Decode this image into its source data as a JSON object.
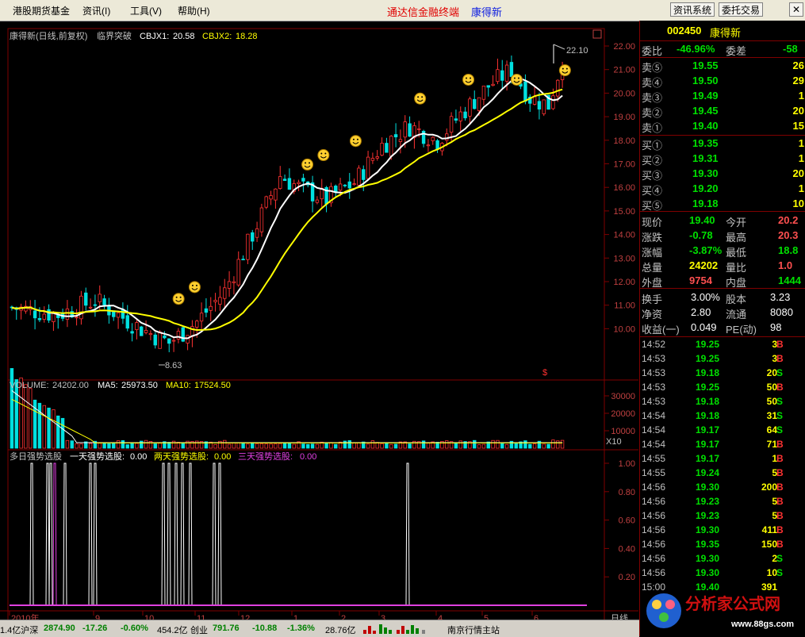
{
  "menu": {
    "items": [
      "港股期货基金",
      "资讯",
      "工具",
      "帮助"
    ],
    "keys": [
      "(I)",
      "(V)",
      "(H)"
    ],
    "center_title": "通达信金融终端",
    "stock_title": "康得新",
    "btn_info": "资讯系统",
    "btn_trade": "委托交易",
    "close": "✕"
  },
  "main_chart": {
    "header_name": "康得新(日线,前复权)",
    "indicator": "临界突破",
    "cbjx1_label": "CBJX1:",
    "cbjx1_value": "20.58",
    "cbjx2_label": "CBJX2:",
    "cbjx2_value": "18.28",
    "high_label": "22.10",
    "low_label": "8.63",
    "yticks": [
      "22.00",
      "21.00",
      "20.00",
      "19.00",
      "18.00",
      "17.00",
      "16.00",
      "15.00",
      "14.00",
      "13.00",
      "12.00",
      "11.00",
      "10.00"
    ],
    "marker": "$"
  },
  "volume_chart": {
    "label": "VOLUME:",
    "value": "24202.00",
    "ma5_label": "MA5:",
    "ma5_value": "25973.50",
    "ma10_label": "MA10:",
    "ma10_value": "17524.50",
    "yticks": [
      "30000",
      "20000",
      "10000"
    ],
    "unit": "X10"
  },
  "signal_chart": {
    "title": "多日强势选股",
    "s1_label": "一天强势选股:",
    "s1_value": "0.00",
    "s2_label": "两天强势选股:",
    "s2_value": "0.00",
    "s3_label": "三天强势选股:",
    "s3_value": "0.00",
    "yticks": [
      "1.00",
      "0.80",
      "0.60",
      "0.40",
      "0.20"
    ]
  },
  "xaxis": {
    "labels": [
      "2010年",
      "9",
      "10",
      "11",
      "12",
      "1",
      "2",
      "3",
      "4",
      "5",
      "6"
    ],
    "period": "日线"
  },
  "quote": {
    "code": "002450",
    "name": "康得新",
    "weibi_label": "委比",
    "weibi_value": "-46.96%",
    "weicha_label": "委差",
    "weicha_value": "-58",
    "asks": [
      {
        "label": "卖⑤",
        "price": "19.55",
        "vol": "26"
      },
      {
        "label": "卖④",
        "price": "19.50",
        "vol": "29"
      },
      {
        "label": "卖③",
        "price": "19.49",
        "vol": "1"
      },
      {
        "label": "卖②",
        "price": "19.45",
        "vol": "20"
      },
      {
        "label": "卖①",
        "price": "19.40",
        "vol": "15"
      }
    ],
    "bids": [
      {
        "label": "买①",
        "price": "19.35",
        "vol": "1"
      },
      {
        "label": "买②",
        "price": "19.31",
        "vol": "1"
      },
      {
        "label": "买③",
        "price": "19.30",
        "vol": "20"
      },
      {
        "label": "买④",
        "price": "19.20",
        "vol": "1"
      },
      {
        "label": "买⑤",
        "price": "19.18",
        "vol": "10"
      }
    ],
    "stats": [
      {
        "l1": "现价",
        "v1": "19.40",
        "l2": "今开",
        "v2": "20.2"
      },
      {
        "l1": "涨跌",
        "v1": "-0.78",
        "l2": "最高",
        "v2": "20.3"
      },
      {
        "l1": "涨幅",
        "v1": "-3.87%",
        "l2": "最低",
        "v2": "18.8"
      },
      {
        "l1": "总量",
        "v1": "24202",
        "l2": "量比",
        "v2": "1.0"
      },
      {
        "l1": "外盘",
        "v1": "9754",
        "l2": "内盘",
        "v2": "1444"
      }
    ],
    "stats2": [
      {
        "l1": "换手",
        "v1": "3.00%",
        "l2": "股本",
        "v2": "3.23"
      },
      {
        "l1": "净资",
        "v1": "2.80",
        "l2": "流通",
        "v2": "8080"
      },
      {
        "l1": "收益(一)",
        "v1": "0.049",
        "l2": "PE(动)",
        "v2": "98"
      }
    ],
    "ticks": [
      {
        "t": "14:52",
        "p": "19.25",
        "v": "3",
        "d": "B"
      },
      {
        "t": "14:53",
        "p": "19.25",
        "v": "3",
        "d": "B"
      },
      {
        "t": "14:53",
        "p": "19.18",
        "v": "20",
        "d": "S"
      },
      {
        "t": "14:53",
        "p": "19.25",
        "v": "50",
        "d": "B"
      },
      {
        "t": "14:53",
        "p": "19.18",
        "v": "50",
        "d": "S"
      },
      {
        "t": "14:54",
        "p": "19.18",
        "v": "31",
        "d": "S"
      },
      {
        "t": "14:54",
        "p": "19.17",
        "v": "64",
        "d": "S"
      },
      {
        "t": "14:54",
        "p": "19.17",
        "v": "71",
        "d": "B"
      },
      {
        "t": "14:55",
        "p": "19.17",
        "v": "1",
        "d": "B"
      },
      {
        "t": "14:55",
        "p": "19.24",
        "v": "5",
        "d": "B"
      },
      {
        "t": "14:56",
        "p": "19.30",
        "v": "200",
        "d": "B"
      },
      {
        "t": "14:56",
        "p": "19.23",
        "v": "5",
        "d": "B"
      },
      {
        "t": "14:56",
        "p": "19.23",
        "v": "5",
        "d": "B"
      },
      {
        "t": "14:56",
        "p": "19.30",
        "v": "411",
        "d": "B"
      },
      {
        "t": "14:56",
        "p": "19.35",
        "v": "150",
        "d": "B"
      },
      {
        "t": "14:56",
        "p": "19.30",
        "v": "2",
        "d": "S"
      },
      {
        "t": "14:56",
        "p": "19.30",
        "v": "10",
        "d": "S"
      },
      {
        "t": "15:00",
        "p": "19.40",
        "v": "391",
        "d": ""
      }
    ]
  },
  "bottom": {
    "idx_info": "1.4亿沪深",
    "hs_value": "2874.90",
    "hs_change": "-17.26",
    "hs_pct": "-0.60%",
    "hs_amount": "454.2亿",
    "cy_label": "创业",
    "cy_value": "791.76",
    "cy_change": "-10.88",
    "cy_pct": "-1.36%",
    "cy_amount": "28.76亿",
    "station": "南京行情主站"
  },
  "logo": {
    "text": "分析家公式网",
    "url": "www.88gs.com"
  },
  "colors": {
    "up": "#ff3232",
    "down": "#00e0e0",
    "ma1": "#ffffff",
    "ma2": "#ffff00",
    "frame": "#800000",
    "price_red": "#ff5050",
    "price_green": "#00e000"
  },
  "chart_data": {
    "type": "candlestick",
    "markers": [
      [
        21,
        11.0
      ],
      [
        23,
        11.5
      ],
      [
        37,
        16.7
      ],
      [
        39,
        17.1
      ],
      [
        43,
        17.7
      ],
      [
        51,
        19.5
      ],
      [
        57,
        20.3
      ],
      [
        63,
        20.3
      ],
      [
        69,
        20.7
      ]
    ]
  }
}
